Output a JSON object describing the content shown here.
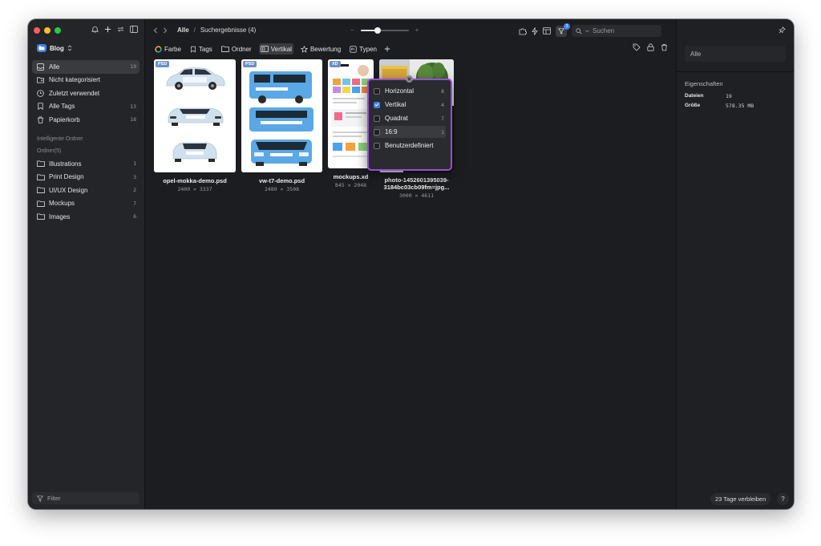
{
  "app": {
    "library_name": "Blog",
    "accent": "#3d7ff5",
    "highlight": "#9b4dd6"
  },
  "sidebar": {
    "items": [
      {
        "label": "Alle",
        "count": "19",
        "icon": "inbox-icon",
        "active": true
      },
      {
        "label": "Nicht kategorisiert",
        "count": "",
        "icon": "uncategorized-icon"
      },
      {
        "label": "Zuletzt verwendet",
        "count": "",
        "icon": "clock-icon"
      },
      {
        "label": "Alle Tags",
        "count": "13",
        "icon": "bookmark-icon"
      },
      {
        "label": "Papierkorb",
        "count": "18",
        "icon": "trash-icon"
      }
    ],
    "smart_folders_label": "Intelligente Ordner",
    "folders_label": "Ordner(5)",
    "folders": [
      {
        "label": "Illustrations",
        "count": "1"
      },
      {
        "label": "Print Design",
        "count": "3"
      },
      {
        "label": "UI/UX Design",
        "count": "2"
      },
      {
        "label": "Mockups",
        "count": "7"
      },
      {
        "label": "Images",
        "count": "6"
      }
    ],
    "filter_placeholder": "Filter"
  },
  "toolbar": {
    "breadcrumb_root": "Alle",
    "breadcrumb_separator": "/",
    "breadcrumb_current": "Suchergebnisse (4)",
    "zoom_minus": "−",
    "zoom_plus": "+",
    "zoom_level": 0.35,
    "filter_badge": "3",
    "search_placeholder": "Suchen"
  },
  "filterbar": {
    "color": "Farbe",
    "tags": "Tags",
    "folder": "Ordner",
    "shape": "Vertikal",
    "rating": "Bewertung",
    "types": "Typen"
  },
  "shape_popup": {
    "options": [
      {
        "label": "Horizontal",
        "count": "8",
        "checked": false
      },
      {
        "label": "Vertikal",
        "count": "4",
        "checked": true
      },
      {
        "label": "Quadrat",
        "count": "7",
        "checked": false
      },
      {
        "label": "16:9",
        "count": "1",
        "checked": false
      },
      {
        "label": "Benutzerdefiniert",
        "count": "",
        "checked": false
      }
    ]
  },
  "files": [
    {
      "name": "opel-mokka-demo.psd",
      "dims": "2400 × 3337",
      "tag": "PSD"
    },
    {
      "name": "vw-t7-demo.psd",
      "dims": "2480 × 3508",
      "tag": "PSD"
    },
    {
      "name": "mockups.xd",
      "dims": "845 × 2048",
      "tag": "XD"
    },
    {
      "name": "photo-1452601395039-",
      "name2": "3184bc03cb09fm=jpg...",
      "dims": "3000 × 4611",
      "tag": ""
    }
  ],
  "inspector": {
    "name_value": "Alle",
    "section_title": "Eigenschaften",
    "files_label": "Dateien",
    "files_value": "19",
    "size_label": "Größe",
    "size_value": "578.35 MB",
    "trial": "23 Tage verbleiben",
    "help": "?"
  }
}
